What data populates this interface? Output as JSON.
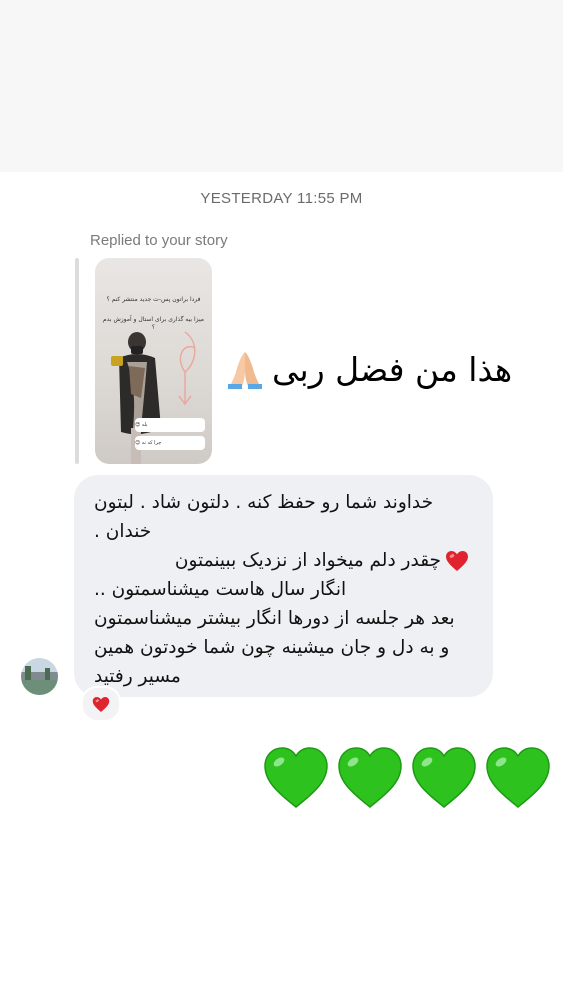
{
  "thread": {
    "timestamp": "YESTERDAY 11:55 PM",
    "replied_label": "Replied to your story"
  },
  "story": {
    "title_text": "فردا براتون پس-ت جدید منتشر کنم ؟",
    "subtitle_text": "میزا بیه گذاری برای استال و آموزش بدم ؟",
    "poll_options": [
      "بله 😍",
      "چرا که نه 😊"
    ]
  },
  "reply_message": {
    "text": "هذا من فضل ربی",
    "emoji_icon": "folded-hands-icon"
  },
  "incoming_message": {
    "lines": [
      "خداوند شما رو حفظ کنه . دلتون شاد . لبتون",
      "خندان .",
      "چقدر دلم میخواد از نزدیک ببینمتون",
      "انگار سال هاست میشناسمتون ..",
      "بعد هر جلسه از دورها انگار بیشتر میشناسمتون",
      "و به دل و جان میشینه چون شما خودتون همین",
      "مسیر رفتید"
    ],
    "inline_heart_icon": "red-heart-icon",
    "reaction_icon": "red-heart-icon"
  },
  "sent_emojis": {
    "icon": "green-heart-icon",
    "count": 4
  },
  "colors": {
    "bubble_bg": "#eff0f3",
    "timestamp": "#6b6b6b",
    "red_heart": "#e0242f",
    "green_heart": "#2ec21f"
  }
}
